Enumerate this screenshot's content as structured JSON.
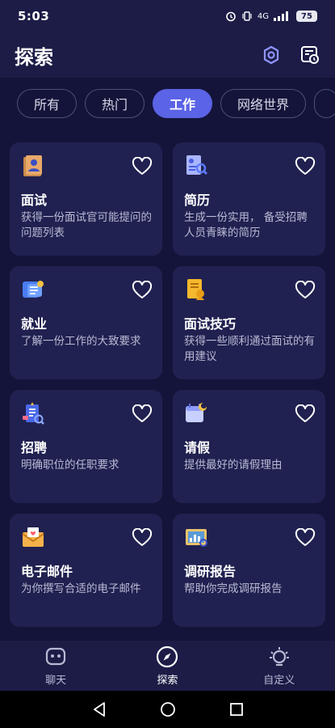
{
  "status": {
    "time": "5:03",
    "network": "4G",
    "battery": "75"
  },
  "header": {
    "title": "探索",
    "icons": [
      "settings-icon",
      "history-icon"
    ]
  },
  "tabs": [
    {
      "label": "所有",
      "active": false
    },
    {
      "label": "热门",
      "active": false
    },
    {
      "label": "工作",
      "active": true
    },
    {
      "label": "网络世界",
      "active": false
    }
  ],
  "cards": [
    {
      "title": "面试",
      "desc": "获得一份面试官可能提问的问题列表",
      "icon": "interview-icon"
    },
    {
      "title": "简历",
      "desc": "生成一份实用， 备受招聘人员青睐的简历",
      "icon": "resume-icon"
    },
    {
      "title": "就业",
      "desc": "了解一份工作的大致要求",
      "icon": "employment-icon"
    },
    {
      "title": "面试技巧",
      "desc": "获得一些顺利通过面试的有用建议",
      "icon": "interview-tips-icon"
    },
    {
      "title": "招聘",
      "desc": "明确职位的任职要求",
      "icon": "recruitment-icon"
    },
    {
      "title": "请假",
      "desc": "提供最好的请假理由",
      "icon": "leave-icon"
    },
    {
      "title": "电子邮件",
      "desc": "为你撰写合适的电子邮件",
      "icon": "email-icon"
    },
    {
      "title": "调研报告",
      "desc": "帮助你完成调研报告",
      "icon": "report-icon"
    }
  ],
  "bottom_nav": [
    {
      "label": "聊天",
      "icon": "chat-icon",
      "active": false
    },
    {
      "label": "探索",
      "icon": "compass-icon",
      "active": true
    },
    {
      "label": "自定义",
      "icon": "lightbulb-icon",
      "active": false
    }
  ],
  "colors": {
    "background": "#14143a",
    "card": "#202150",
    "accent": "#5b63e6"
  }
}
